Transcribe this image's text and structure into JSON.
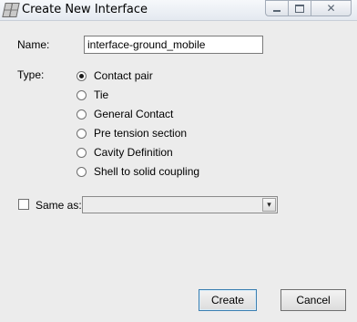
{
  "window": {
    "title": "Create New Interface",
    "controls": {
      "minimize_icon": "minimize-icon",
      "maximize_icon": "maximize-icon",
      "close_icon": "close-icon"
    }
  },
  "form": {
    "name_label": "Name:",
    "name_value": "interface-ground_mobile",
    "type_label": "Type:",
    "types": [
      {
        "label": "Contact pair",
        "selected": true
      },
      {
        "label": "Tie",
        "selected": false
      },
      {
        "label": "General Contact",
        "selected": false
      },
      {
        "label": "Pre tension section",
        "selected": false
      },
      {
        "label": "Cavity Definition",
        "selected": false
      },
      {
        "label": "Shell to solid coupling",
        "selected": false
      }
    ],
    "same_as_label": "Same as:",
    "same_as_checked": false,
    "same_as_value": ""
  },
  "buttons": {
    "create": "Create",
    "cancel": "Cancel"
  }
}
